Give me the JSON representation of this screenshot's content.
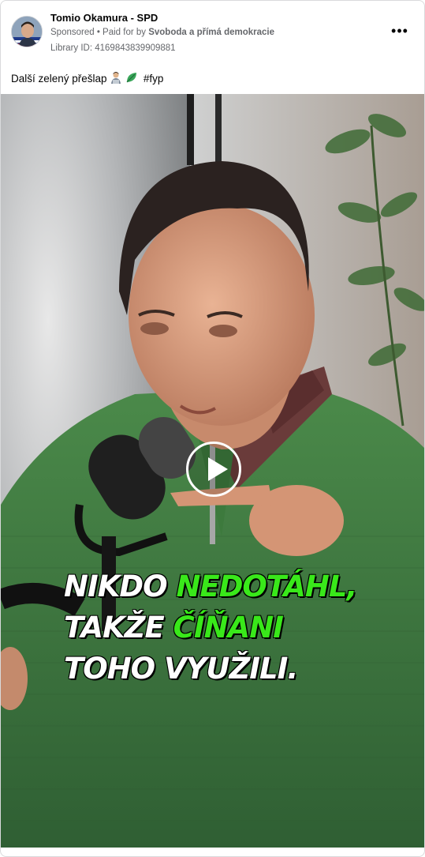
{
  "post": {
    "page_name": "Tomio Okamura - SPD",
    "sponsored": "Sponsored",
    "separator": " • ",
    "paid_for_prefix": "Paid for by ",
    "paid_for_name": "Svoboda a přímá demokracie",
    "library_id": "Library ID: 4169843839909881",
    "more_label": "•••",
    "caption_text": "Další zelený přešlap",
    "caption_hashtag": "#fyp",
    "caption_emojis": [
      "man-technologist-emoji",
      "leaf-emoji"
    ]
  },
  "video": {
    "overlay_lines": [
      {
        "parts": [
          {
            "text": "Nikdo ",
            "color": "white"
          },
          {
            "text": "nedotáhl,",
            "color": "green"
          }
        ]
      },
      {
        "parts": [
          {
            "text": "takže ",
            "color": "white"
          },
          {
            "text": "Číňani",
            "color": "green"
          }
        ]
      },
      {
        "parts": [
          {
            "text": "toho využili.",
            "color": "white"
          }
        ]
      }
    ]
  },
  "colors": {
    "overlay_green": "#39e81a",
    "sweater_green": "#3f7d3f",
    "text_secondary": "#65676b"
  }
}
